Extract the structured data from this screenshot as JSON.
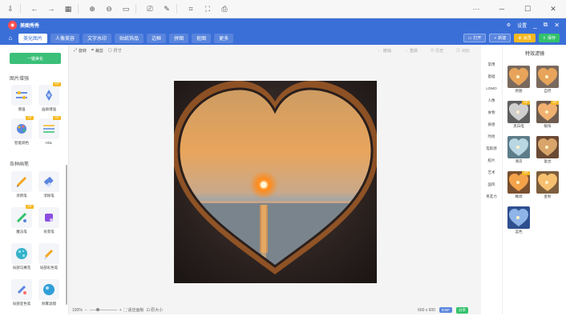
{
  "app": {
    "name": "美图秀秀",
    "settings_label": "设置"
  },
  "nav": {
    "tabs": [
      "美化图片",
      "人像美容",
      "文字水印",
      "贴纸饰品",
      "边框",
      "拼图",
      "抠图",
      "更多"
    ],
    "active_tab": 0,
    "open_label": "打开",
    "new_label": "新建",
    "vip_label": "会员",
    "save_label": "保存"
  },
  "left": {
    "oneclick_label": "一键美化",
    "section1_title": "图片增强",
    "section1_tools": [
      {
        "label": "增强",
        "vip": false,
        "icon": "sliders-icon"
      },
      {
        "label": "画质增强",
        "vip": true,
        "icon": "enhance-icon"
      },
      {
        "label": "智能调色",
        "vip": true,
        "icon": "palette-icon"
      },
      {
        "label": "HSL",
        "vip": true,
        "icon": "hsl-icon"
      }
    ],
    "section2_title": "各种画笔",
    "section2_tools": [
      {
        "label": "涂鸦笔",
        "vip": false,
        "icon": "pen-icon"
      },
      {
        "label": "消除笔",
        "vip": false,
        "icon": "eraser-icon"
      },
      {
        "label": "魔法笔",
        "vip": true,
        "icon": "magic-pen-icon"
      },
      {
        "label": "背景笔",
        "vip": false,
        "icon": "bg-pen-icon"
      },
      {
        "label": "局部马赛克",
        "vip": false,
        "icon": "mosaic-icon"
      },
      {
        "label": "局部彩色笔",
        "vip": false,
        "icon": "color-brush-icon"
      },
      {
        "label": "局部变色笔",
        "vip": false,
        "icon": "recolor-icon"
      },
      {
        "label": "除雾滤镜",
        "vip": false,
        "icon": "dehaze-icon"
      }
    ]
  },
  "canvas_toolbar": {
    "rotate": "旋转",
    "crop": "裁剪",
    "size": "尺寸",
    "undo": "撤销",
    "redo": "重做",
    "history": "历史",
    "compare": "对比"
  },
  "bottom": {
    "zoom": "100%",
    "fit": "适应画板",
    "original": "原大小",
    "dims": "600 x 600",
    "export_label": "EXIF",
    "share_label": "分享"
  },
  "categories": [
    "常用",
    "基础",
    "LOMO",
    "人像",
    "食物",
    "质感",
    "时尚",
    "电影感",
    "胶片",
    "艺术",
    "国风",
    "男友力"
  ],
  "filters": {
    "title": "特效滤镜",
    "items": [
      {
        "label": "原图",
        "vip": false,
        "tone": "warm"
      },
      {
        "label": "自然",
        "vip": false,
        "tone": "warm"
      },
      {
        "label": "黑白电",
        "vip": true,
        "tone": "gray"
      },
      {
        "label": "暖阳",
        "vip": true,
        "tone": "warm2"
      },
      {
        "label": "清凉",
        "vip": false,
        "tone": "cool"
      },
      {
        "label": "复古",
        "vip": false,
        "tone": "retro"
      },
      {
        "label": "橘调",
        "vip": true,
        "tone": "orange"
      },
      {
        "label": "金秋",
        "vip": false,
        "tone": "golden"
      },
      {
        "label": "蓝色",
        "vip": false,
        "tone": "blue"
      }
    ]
  },
  "colors": {
    "brand": "#3b6fd8",
    "accent_green": "#33c26b",
    "vip_gold": "#f5b820"
  }
}
